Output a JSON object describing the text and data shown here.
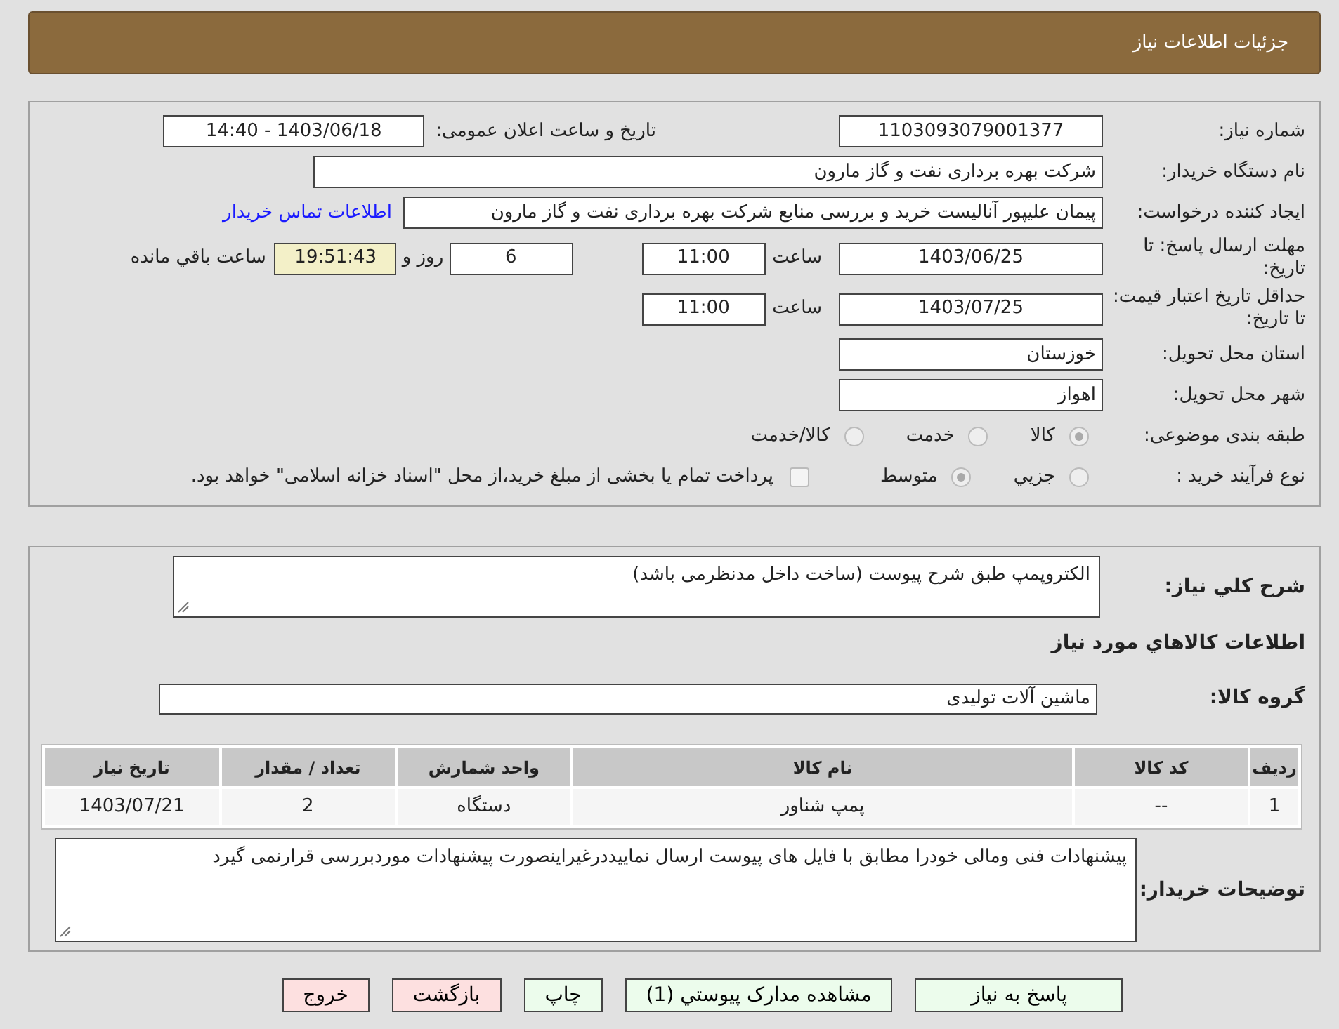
{
  "header": {
    "title": "جزئیات اطلاعات نیاز"
  },
  "need_number": {
    "label": "شماره نیاز:",
    "value": "1103093079001377"
  },
  "announce": {
    "label": "تاریخ و ساعت اعلان عمومی:",
    "value": "1403/06/18 - 14:40"
  },
  "buyer": {
    "label": "نام دستگاه خریدار:",
    "value": "شرکت بهره برداری نفت و گاز مارون"
  },
  "requester": {
    "label": "ایجاد کننده درخواست:",
    "value": "پیمان علیپور آنالیست خرید و بررسی منابع شرکت بهره برداری نفت و گاز مارون",
    "link": "اطلاعات تماس خریدار"
  },
  "deadline": {
    "label": "مهلت ارسال پاسخ: تا تاریخ:",
    "date": "1403/06/25",
    "time_label": "ساعت",
    "time": "11:00",
    "days": "6",
    "days_label": "روز و",
    "remaining": "19:51:43",
    "remaining_label": "ساعت باقي مانده"
  },
  "validity": {
    "label": "حداقل تاریخ اعتبار قیمت: تا تاریخ:",
    "date": "1403/07/25",
    "time_label": "ساعت",
    "time": "11:00"
  },
  "province": {
    "label": "استان محل تحویل:",
    "value": "خوزستان"
  },
  "city": {
    "label": "شهر محل تحویل:",
    "value": "اهواز"
  },
  "category": {
    "label": "طبقه بندی موضوعی:",
    "options": [
      {
        "label": "کالا",
        "selected": true
      },
      {
        "label": "خدمت",
        "selected": false
      },
      {
        "label": "کالا/خدمت",
        "selected": false
      }
    ]
  },
  "process": {
    "label": "نوع فرآیند خرید :",
    "options": [
      {
        "label": "جزيي",
        "selected": false
      },
      {
        "label": "متوسط",
        "selected": true
      }
    ],
    "payment": {
      "checked": false,
      "text": "پرداخت تمام یا بخشی از مبلغ خرید،از محل \"اسناد خزانه اسلامی\" خواهد بود."
    }
  },
  "description": {
    "label": "شرح کلي نیاز:",
    "value": "الکتروپمپ طبق شرح پیوست (ساخت داخل مدنظرمی باشد)"
  },
  "goods_heading": "اطلاعات کالاهاي مورد نیاز",
  "goods_group": {
    "label": "گروه کالا:",
    "value": "ماشین آلات تولیدی"
  },
  "table": {
    "columns": [
      "ردیف",
      "کد کالا",
      "نام کالا",
      "واحد شمارش",
      "تعداد / مقدار",
      "تاریخ نیاز"
    ],
    "rows": [
      [
        "1",
        "--",
        "پمپ شناور",
        "دستگاه",
        "2",
        "1403/07/21"
      ]
    ]
  },
  "buyer_notes": {
    "label": "توضیحات خریدار:",
    "value": "پیشنهادات فنی ومالی خودرا  مطابق با فایل های پیوست ارسال نماییددرغیراینصورت پیشنهادات موردبررسی قرارنمی گیرد"
  },
  "buttons": [
    {
      "label": "پاسخ به نیاز",
      "kind": "go"
    },
    {
      "label": "مشاهده مدارک پیوستي (1)",
      "kind": "go"
    },
    {
      "label": "چاپ",
      "kind": "go"
    },
    {
      "label": "بازگشت",
      "kind": "stop"
    },
    {
      "label": "خروج",
      "kind": "stop"
    }
  ]
}
